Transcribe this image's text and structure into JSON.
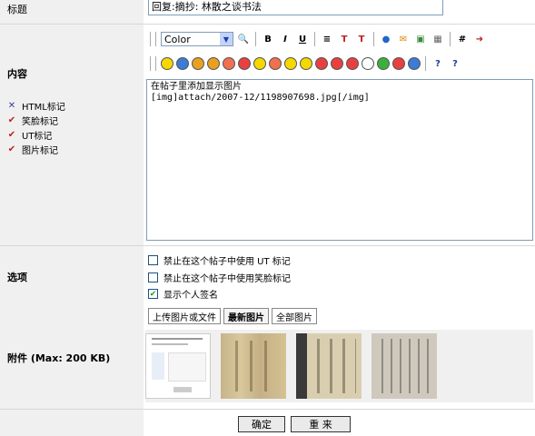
{
  "labels": {
    "title": "标题",
    "content": "内容",
    "options": "选项",
    "attachment": "附件 (Max: 200 KB)"
  },
  "flags": [
    {
      "label": "HTML标记",
      "state": "off"
    },
    {
      "label": "笑脸标记",
      "state": "on"
    },
    {
      "label": "UT标记",
      "state": "on"
    },
    {
      "label": "图片标记",
      "state": "on"
    }
  ],
  "title_value": "回复:摘抄: 林散之谈书法",
  "toolbar": {
    "color_select": "Color",
    "icons": [
      "zoom-icon",
      "bold-icon",
      "italic-icon",
      "underline-icon",
      "center-align-icon",
      "font-size-up-icon",
      "font-size-down-icon",
      "link-icon",
      "email-icon",
      "image-icon",
      "table-icon",
      "hash-icon",
      "quote-icon"
    ],
    "bold_label": "B",
    "italic_label": "I",
    "underline_label": "U",
    "hash_label": "#"
  },
  "smileys": [
    "#f5d800",
    "#3c7bd6",
    "#e8a020",
    "#e8a020",
    "#f07050",
    "#e84040",
    "#f5d800",
    "#f07050",
    "#f5d800",
    "#f5d800",
    "#e84040",
    "#e84040",
    "#e84040",
    "#ffffff",
    "#3cb03c",
    "#e84040",
    "#3c7bd6"
  ],
  "content_text": "在帖子里添加显示图片\n[img]attach/2007-12/1198907698.jpg[/img]",
  "options": [
    {
      "label": "禁止在这个帖子中使用 UT 标记",
      "checked": false
    },
    {
      "label": "禁止在这个帖子中使用笑脸标记",
      "checked": false
    },
    {
      "label": "显示个人签名",
      "checked": true
    }
  ],
  "tabs": [
    "上传图片或文件",
    "最新图片",
    "全部图片"
  ],
  "buttons": {
    "submit": "确定",
    "reset": "重 来"
  }
}
